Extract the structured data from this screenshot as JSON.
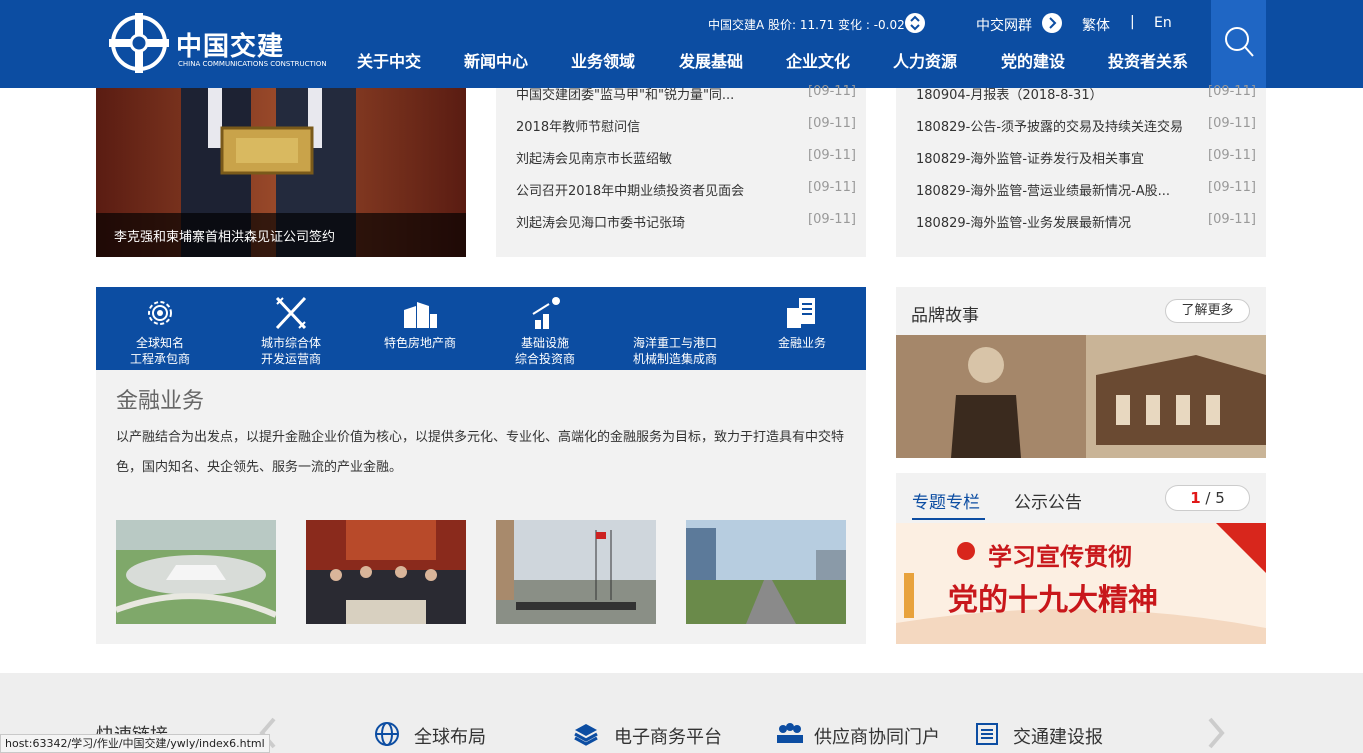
{
  "header": {
    "logo_cn": "中国交建",
    "logo_en": "CHINA COMMUNICATIONS CONSTRUCTION",
    "stock_text": "中国交建A 股价: 11.71 变化 : -0.02",
    "network_label": "中交网群",
    "lang_traditional": "繁体",
    "lang_separator": "|",
    "lang_english": "En",
    "nav": [
      "关于中交",
      "新闻中心",
      "业务领域",
      "发展基础",
      "企业文化",
      "人力资源",
      "党的建设",
      "投资者关系"
    ]
  },
  "featured": {
    "caption": "李克强和柬埔寨首相洪森见证公司签约"
  },
  "news_left": [
    {
      "title": "中国交建团委\"监马甲\"和\"锐力量\"同...",
      "date": "[09-11]"
    },
    {
      "title": "2018年教师节慰问信",
      "date": "[09-11]"
    },
    {
      "title": "刘起涛会见南京市长蓝绍敏",
      "date": "[09-11]"
    },
    {
      "title": "公司召开2018年中期业绩投资者见面会",
      "date": "[09-11]"
    },
    {
      "title": "刘起涛会见海口市委书记张琦",
      "date": "[09-11]"
    }
  ],
  "news_right": [
    {
      "title": "180904-月报表（2018-8-31）",
      "date": "[09-11]"
    },
    {
      "title": "180829-公告-须予披露的交易及持续关连交易",
      "date": "[09-11]"
    },
    {
      "title": "180829-海外监管-证券发行及相关事宜",
      "date": "[09-11]"
    },
    {
      "title": "180829-海外监管-营运业绩最新情况-A股...",
      "date": "[09-11]"
    },
    {
      "title": "180829-海外监管-业务发展最新情况",
      "date": "[09-11]"
    }
  ],
  "business": {
    "tabs": [
      {
        "line1": "全球知名",
        "line2": "工程承包商",
        "icon": "gear-icon"
      },
      {
        "line1": "城市综合体",
        "line2": "开发运营商",
        "icon": "city-icon"
      },
      {
        "line1": "特色房地产商",
        "line2": "",
        "icon": "building-icon"
      },
      {
        "line1": "基础设施",
        "line2": "综合投资商",
        "icon": "chart-icon"
      },
      {
        "line1": "海洋重工与港口",
        "line2": "机械制造集成商",
        "icon": "crane-icon"
      },
      {
        "line1": "金融业务",
        "line2": "",
        "icon": "finance-icon"
      }
    ],
    "title": "金融业务",
    "description": "以产融结合为出发点，以提升金融企业价值为核心，以提供多元化、专业化、高端化的金融服务为目标，致力于打造具有中交特色，国内知名、央企领先、服务一流的产业金融。"
  },
  "brand": {
    "title": "品牌故事",
    "more_label": "了解更多"
  },
  "topic": {
    "tab_active": "专题专栏",
    "tab_other": "公示公告",
    "page_current": "1",
    "page_sep": "/",
    "page_total": "5",
    "banner_line1": "学习宣传贯彻",
    "banner_line2": "党的十九大精神"
  },
  "footer": {
    "quick_title": "快速链接",
    "links": [
      "全球布局",
      "电子商务平台",
      "供应商协同门户",
      "交通建设报"
    ]
  },
  "status_bar": "host:63342/学习/作业/中国交建/ywly/index6.html",
  "colors": {
    "primary": "#0c4da2",
    "panel": "#f2f2f2",
    "accent_red": "#e01818"
  }
}
